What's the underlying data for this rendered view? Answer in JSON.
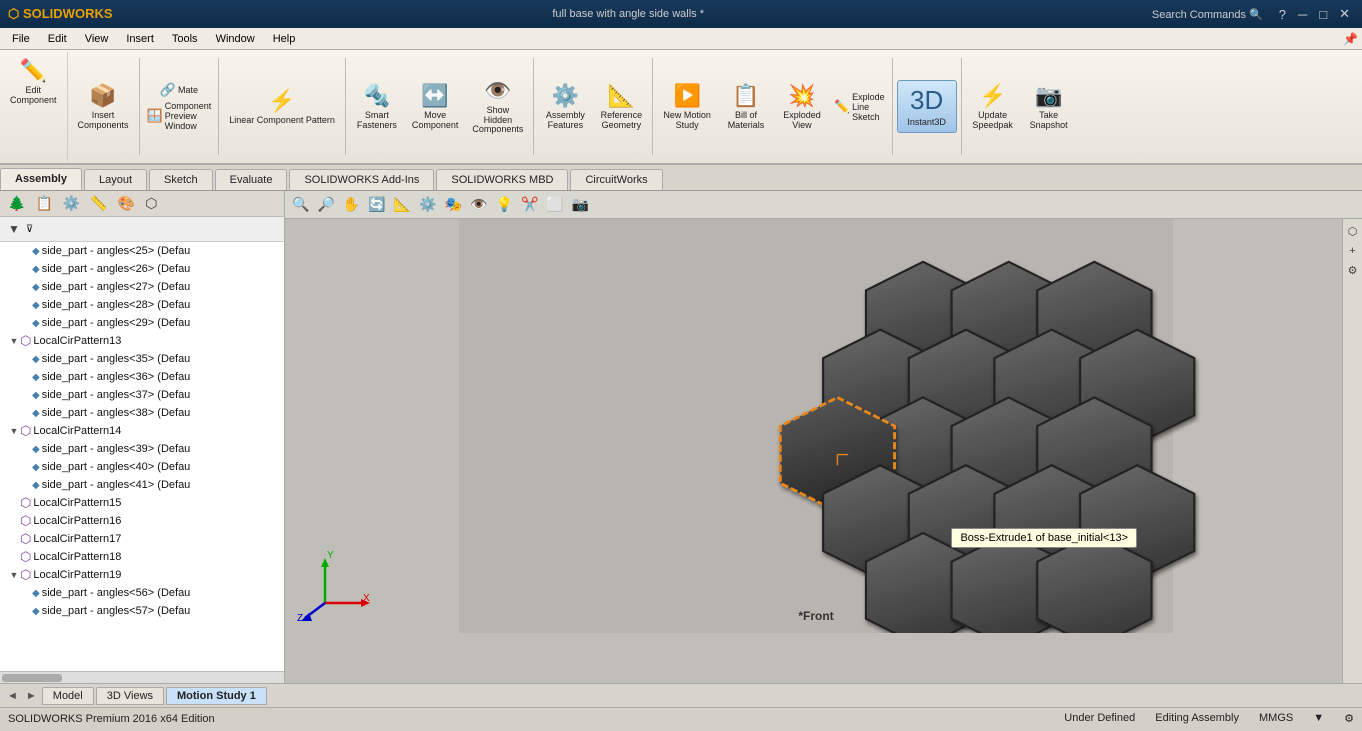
{
  "titlebar": {
    "logo": "SW",
    "title": "full base with angle side walls *",
    "search_placeholder": "Search Commands",
    "minimize": "─",
    "restore": "□",
    "close": "✕"
  },
  "menubar": {
    "items": [
      "File",
      "Edit",
      "View",
      "Insert",
      "Tools",
      "Window",
      "Help"
    ]
  },
  "ribbon": {
    "edit_component": "Edit\nComponent",
    "insert_components": "Insert\nComponents",
    "mate": "Mate",
    "component_preview_window": "Component\nPreview\nWindow",
    "linear_component_pattern": "Linear Component\nPattern",
    "smart_fasteners": "Smart\nFasteners",
    "move_component": "Move\nComponent",
    "show_hidden_components": "Show\nHidden\nComponents",
    "assembly_features": "Assembly\nFeatures",
    "reference_geometry": "Reference\nGeometry",
    "new_motion_study": "New Motion\nStudy",
    "bill_of_materials": "Bill of\nMaterials",
    "exploded_view": "Exploded\nView",
    "explode_line_sketch": "Explode\nLine\nSketch",
    "instant3d": "Instant3D",
    "update_speedpak": "Update\nSpeedpak",
    "take_snapshot": "Take\nSnapshot"
  },
  "tabs": {
    "items": [
      "Assembly",
      "Layout",
      "Sketch",
      "Evaluate",
      "SOLIDWORKS Add-Ins",
      "SOLIDWORKS MBD",
      "CircuitWorks"
    ]
  },
  "left_panel": {
    "filter_label": "▼",
    "tree_items": [
      {
        "level": 2,
        "type": "part",
        "text": "side_part - angles<25> (Defau",
        "expandable": false
      },
      {
        "level": 2,
        "type": "part",
        "text": "side_part - angles<26> (Defau",
        "expandable": false
      },
      {
        "level": 2,
        "type": "part",
        "text": "side_part - angles<27> (Defau",
        "expandable": false
      },
      {
        "level": 2,
        "type": "part",
        "text": "side_part - angles<28> (Defau",
        "expandable": false
      },
      {
        "level": 2,
        "type": "part",
        "text": "side_part - angles<29> (Defau",
        "expandable": false
      },
      {
        "level": 1,
        "type": "pattern",
        "text": "LocalCirPattern13",
        "expandable": true
      },
      {
        "level": 2,
        "type": "part",
        "text": "side_part - angles<35> (Defau",
        "expandable": false
      },
      {
        "level": 2,
        "type": "part",
        "text": "side_part - angles<36> (Defau",
        "expandable": false
      },
      {
        "level": 2,
        "type": "part",
        "text": "side_part - angles<37> (Defau",
        "expandable": false
      },
      {
        "level": 2,
        "type": "part",
        "text": "side_part - angles<38> (Defau",
        "expandable": false
      },
      {
        "level": 1,
        "type": "pattern",
        "text": "LocalCirPattern14",
        "expandable": true
      },
      {
        "level": 2,
        "type": "part",
        "text": "side_part - angles<39> (Defau",
        "expandable": false
      },
      {
        "level": 2,
        "type": "part",
        "text": "side_part - angles<40> (Defau",
        "expandable": false
      },
      {
        "level": 2,
        "type": "part",
        "text": "side_part - angles<41> (Defau",
        "expandable": false
      },
      {
        "level": 1,
        "type": "pattern",
        "text": "LocalCirPattern15",
        "expandable": false
      },
      {
        "level": 1,
        "type": "pattern",
        "text": "LocalCirPattern16",
        "expandable": false
      },
      {
        "level": 1,
        "type": "pattern",
        "text": "LocalCirPattern17",
        "expandable": false
      },
      {
        "level": 1,
        "type": "pattern",
        "text": "LocalCirPattern18",
        "expandable": false
      },
      {
        "level": 1,
        "type": "pattern",
        "text": "LocalCirPattern19",
        "expandable": true
      },
      {
        "level": 2,
        "type": "part",
        "text": "side_part - angles<56> (Defau",
        "expandable": false
      },
      {
        "level": 2,
        "type": "part",
        "text": "side_part - angles<57> (Defau",
        "expandable": false
      }
    ]
  },
  "viewport": {
    "tooltip_text": "Boss-Extrude1 of base_initial<13>",
    "view_label": "*Front"
  },
  "bottom_tabs": {
    "nav_prev": "◄",
    "nav_next": "►",
    "items": [
      "Model",
      "3D Views",
      "Motion Study 1"
    ]
  },
  "statusbar": {
    "under_defined": "Under Defined",
    "editing_assembly": "Editing Assembly",
    "units": "MMGS",
    "version": "SOLIDWORKS Premium 2016 x64 Edition"
  }
}
